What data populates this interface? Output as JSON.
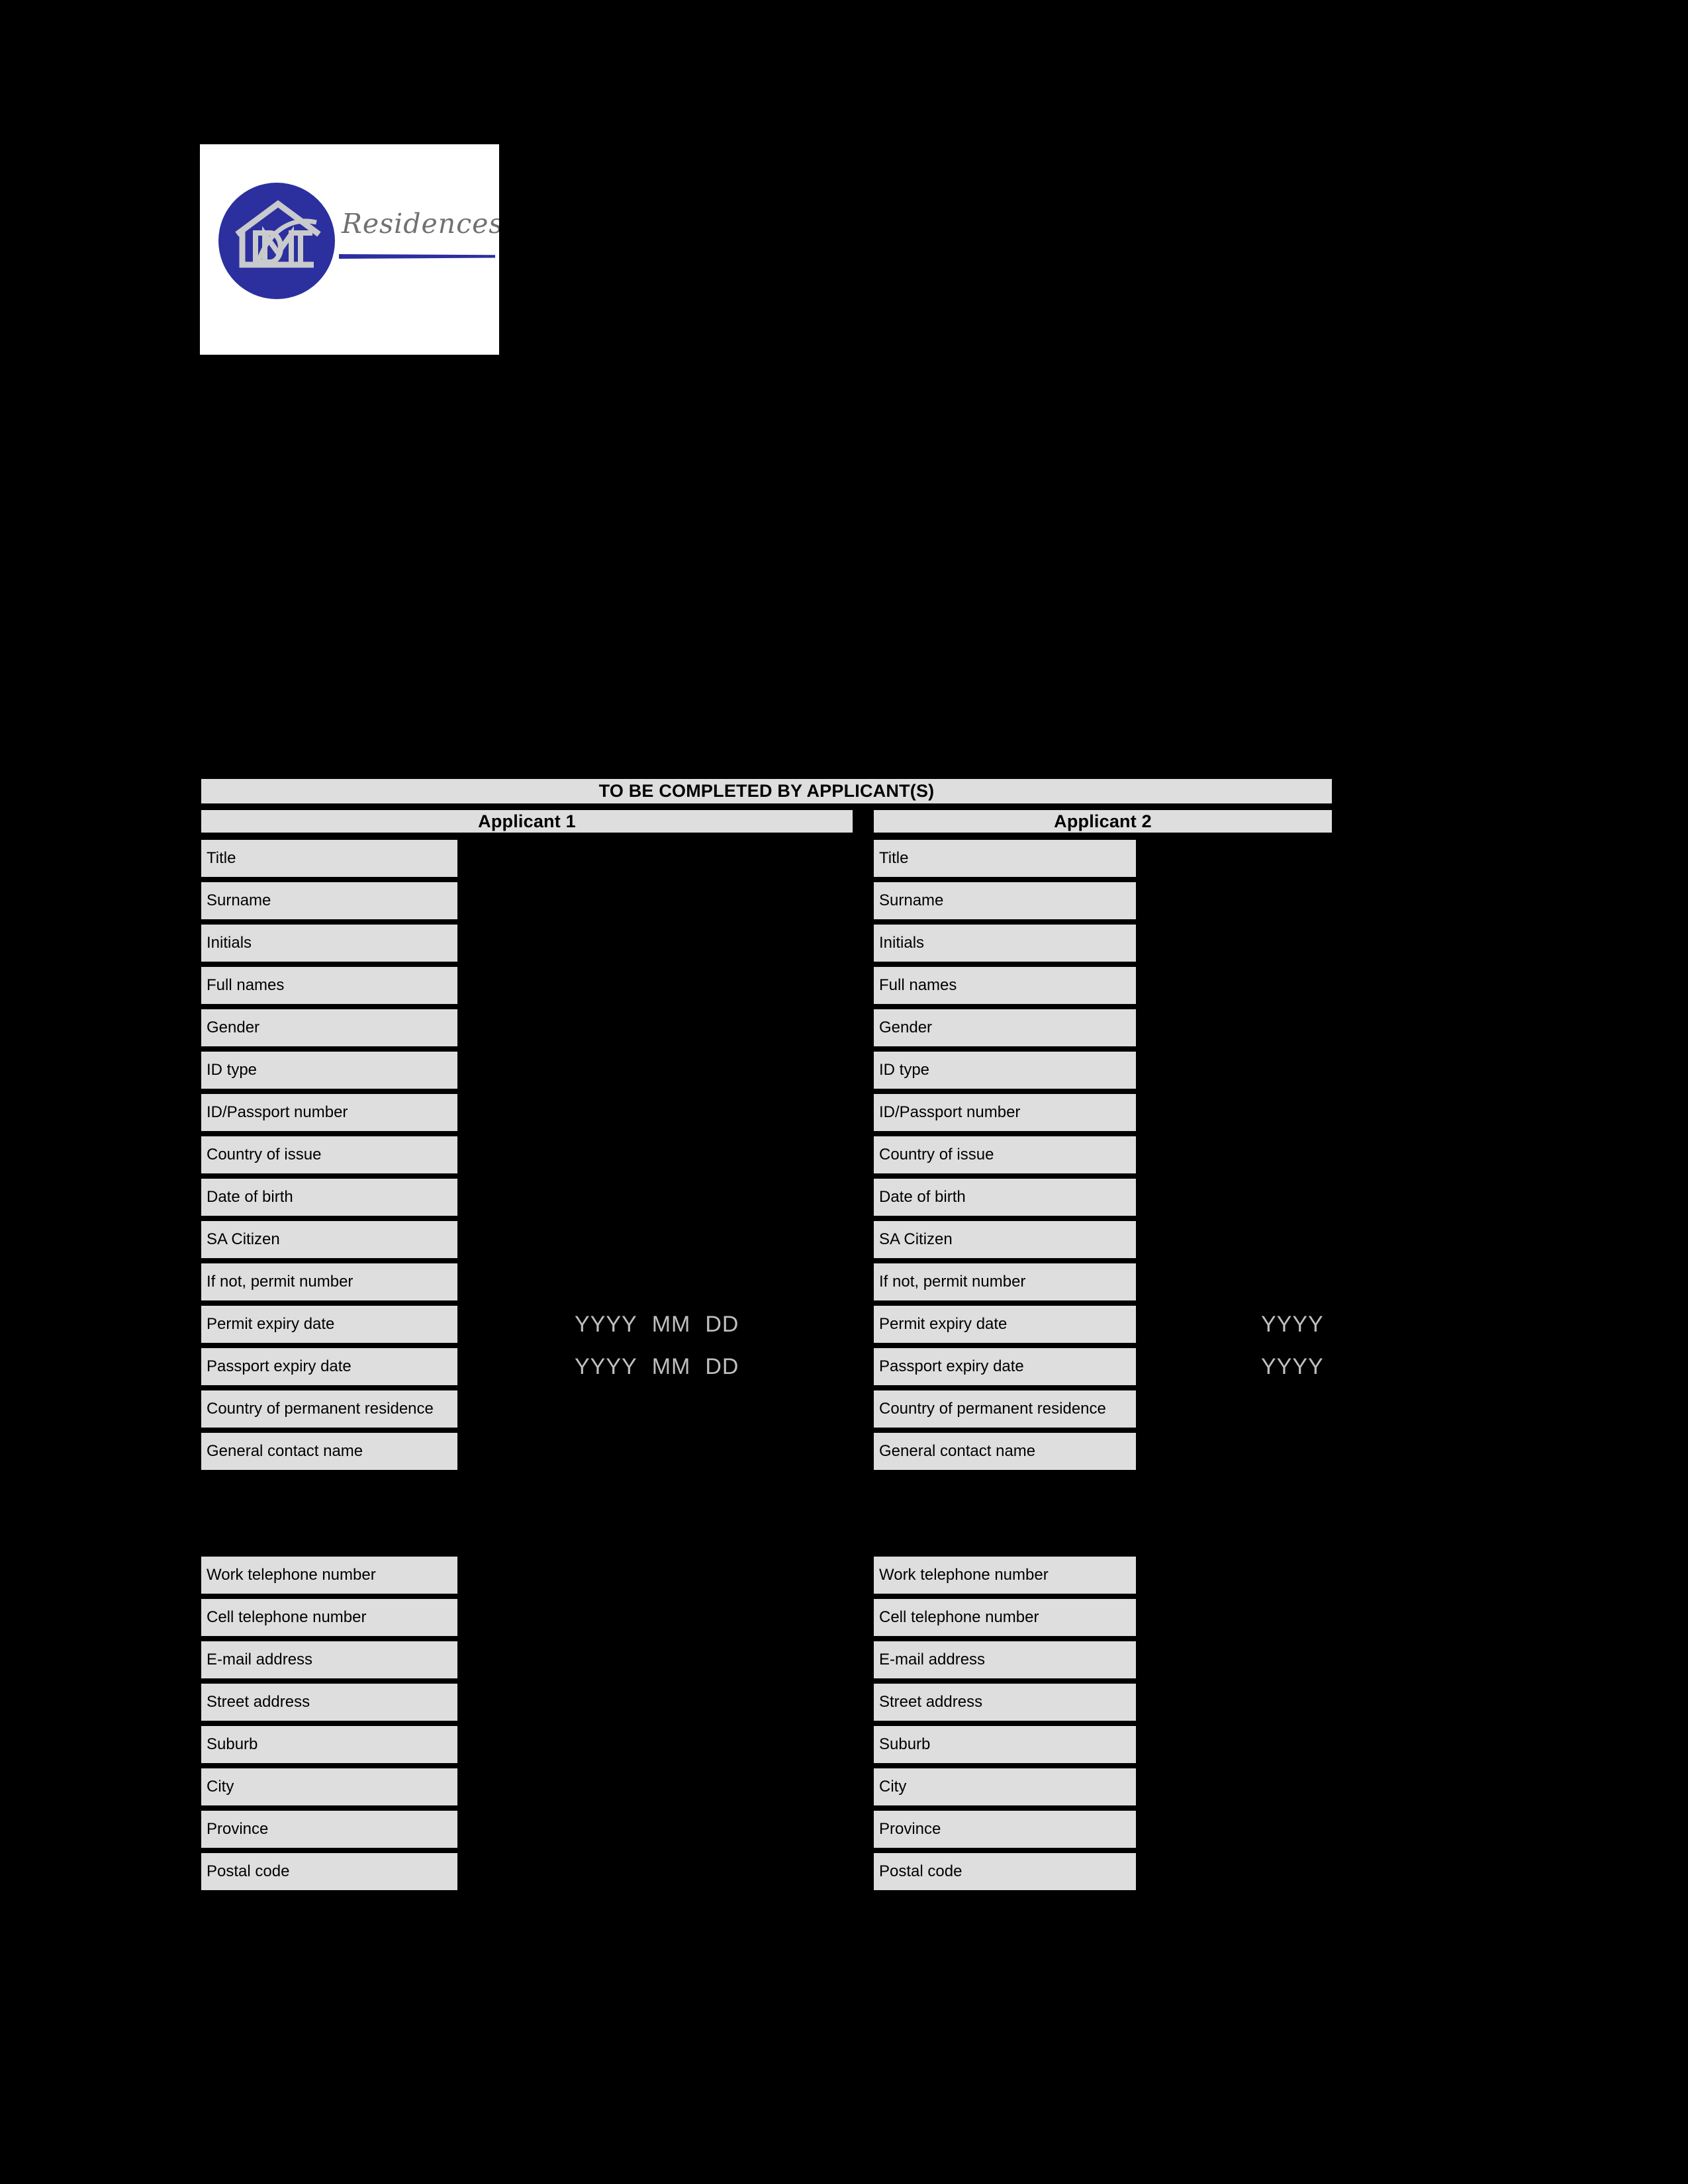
{
  "logo": {
    "brand_mark_text": "MT",
    "brand_word": "Residences",
    "circle_color": "#2c2f9e",
    "house_color": "#c9cacc",
    "script_color": "#6f7173"
  },
  "form": {
    "title": "TO BE COMPLETED BY APPLICANT(S)",
    "columns": [
      {
        "heading": "Applicant 1"
      },
      {
        "heading": "Applicant 2"
      }
    ],
    "identity_labels": [
      "Title",
      "Surname",
      "Initials",
      "Full names",
      "Gender",
      "ID type",
      "ID/Passport number",
      "Country of issue",
      "Date of birth",
      "SA Citizen",
      "If not, permit number",
      "Permit expiry date",
      "Passport expiry date",
      "Country of permanent residence",
      "General contact name"
    ],
    "contact_labels": [
      "Work telephone number",
      "Cell telephone number",
      "E-mail address",
      "Street address",
      "Suburb",
      "City",
      "Province",
      "Postal code"
    ],
    "date_hints": {
      "applicant1": {
        "permit_expiry": [
          "YYYY",
          "MM",
          "DD"
        ],
        "passport_expiry": [
          "YYYY",
          "MM",
          "DD"
        ]
      },
      "applicant2": {
        "permit_expiry": [
          "YYYY"
        ],
        "passport_expiry": [
          "YYYY"
        ]
      }
    },
    "colors": {
      "page_background": "#000000",
      "cell_fill": "#dedede",
      "cell_border": "#000000",
      "hint_text": "#bfbfbf"
    }
  }
}
